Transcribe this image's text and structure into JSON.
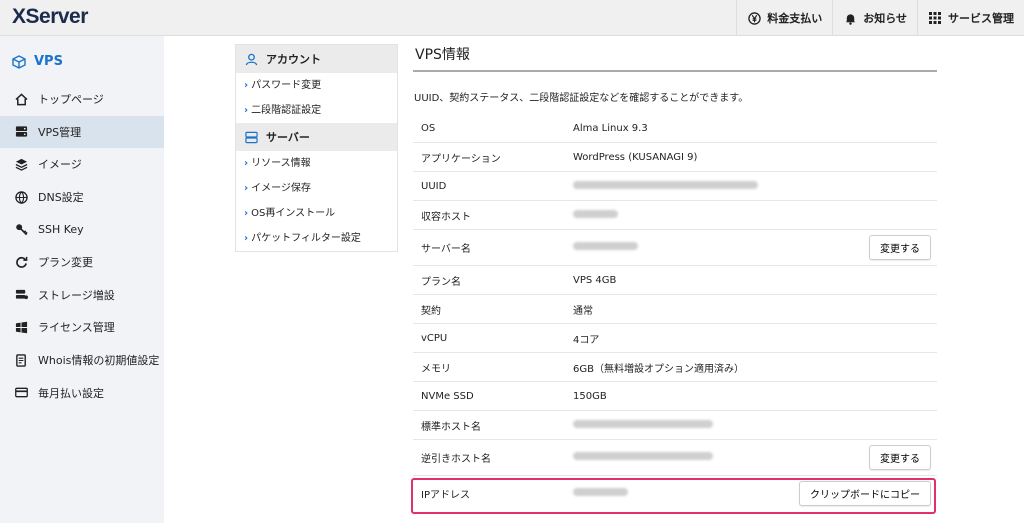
{
  "topbar": {
    "logo": "XServer",
    "nav": [
      {
        "label": "料金支払い",
        "icon": "yen-icon"
      },
      {
        "label": "お知らせ",
        "icon": "bell-icon"
      },
      {
        "label": "サービス管理",
        "icon": "grid-icon"
      }
    ]
  },
  "sidebar": {
    "title": "VPS",
    "items": [
      {
        "label": "トップページ",
        "icon": "home-icon"
      },
      {
        "label": "VPS管理",
        "icon": "server-icon"
      },
      {
        "label": "イメージ",
        "icon": "layers-icon"
      },
      {
        "label": "DNS設定",
        "icon": "globe-icon"
      },
      {
        "label": "SSH Key",
        "icon": "key-icon"
      },
      {
        "label": "プラン変更",
        "icon": "refresh-icon"
      },
      {
        "label": "ストレージ増設",
        "icon": "database-icon"
      },
      {
        "label": "ライセンス管理",
        "icon": "windows-icon"
      },
      {
        "label": "Whois情報の初期値設定",
        "icon": "document-icon"
      },
      {
        "label": "毎月払い設定",
        "icon": "card-icon"
      }
    ]
  },
  "subnav": {
    "account_head": "アカウント",
    "account_items": [
      "パスワード変更",
      "二段階認証設定"
    ],
    "server_head": "サーバー",
    "server_items": [
      "リソース情報",
      "イメージ保存",
      "OS再インストール",
      "パケットフィルター設定"
    ]
  },
  "main": {
    "title": "VPS情報",
    "description": "UUID、契約ステータス、二段階認証設定などを確認することができます。"
  },
  "table": {
    "rows": [
      {
        "key": "OS",
        "value": "Alma Linux 9.3"
      },
      {
        "key": "アプリケーション",
        "value": "WordPress (KUSANAGI 9)"
      },
      {
        "key": "UUID",
        "value": ""
      },
      {
        "key": "収容ホスト",
        "value": ""
      },
      {
        "key": "サーバー名",
        "value": "",
        "button": "変更する"
      },
      {
        "key": "プラン名",
        "value": "VPS 4GB"
      },
      {
        "key": "契約",
        "value": "通常"
      },
      {
        "key": "vCPU",
        "value": "4コア"
      },
      {
        "key": "メモリ",
        "value": "6GB（無料増設オプション適用済み）"
      },
      {
        "key": "NVMe SSD",
        "value": "150GB"
      },
      {
        "key": "標準ホスト名",
        "value": ""
      },
      {
        "key": "逆引きホスト名",
        "value": "",
        "button": "変更する"
      },
      {
        "key": "IPアドレス",
        "value": "",
        "button": "クリップボードにコピー"
      }
    ]
  }
}
